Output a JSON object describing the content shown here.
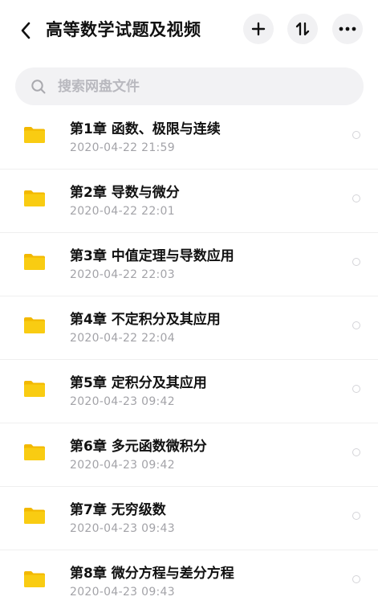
{
  "header": {
    "title": "高等数学试题及视频"
  },
  "search": {
    "placeholder": "搜索网盘文件"
  },
  "colors": {
    "folder": "#f7c600",
    "folder_back": "#f2b800",
    "button_bg": "#f1f1f3",
    "date": "#a3a3a8"
  },
  "icons": [
    "back-arrow-icon",
    "plus-icon",
    "sort-icon",
    "more-icon",
    "search-icon",
    "folder-icon",
    "select-circle-icon"
  ],
  "files": [
    {
      "name": "第1章 函数、极限与连续",
      "date": "2020-04-22  21:59"
    },
    {
      "name": "第2章 导数与微分",
      "date": "2020-04-22  22:01"
    },
    {
      "name": "第3章 中值定理与导数应用",
      "date": "2020-04-22  22:03"
    },
    {
      "name": "第4章 不定积分及其应用",
      "date": "2020-04-22  22:04"
    },
    {
      "name": "第5章 定积分及其应用",
      "date": "2020-04-23  09:42"
    },
    {
      "name": "第6章 多元函数微积分",
      "date": "2020-04-23  09:42"
    },
    {
      "name": "第7章 无穷级数",
      "date": "2020-04-23  09:43"
    },
    {
      "name": "第8章 微分方程与差分方程",
      "date": "2020-04-23  09:43"
    }
  ]
}
